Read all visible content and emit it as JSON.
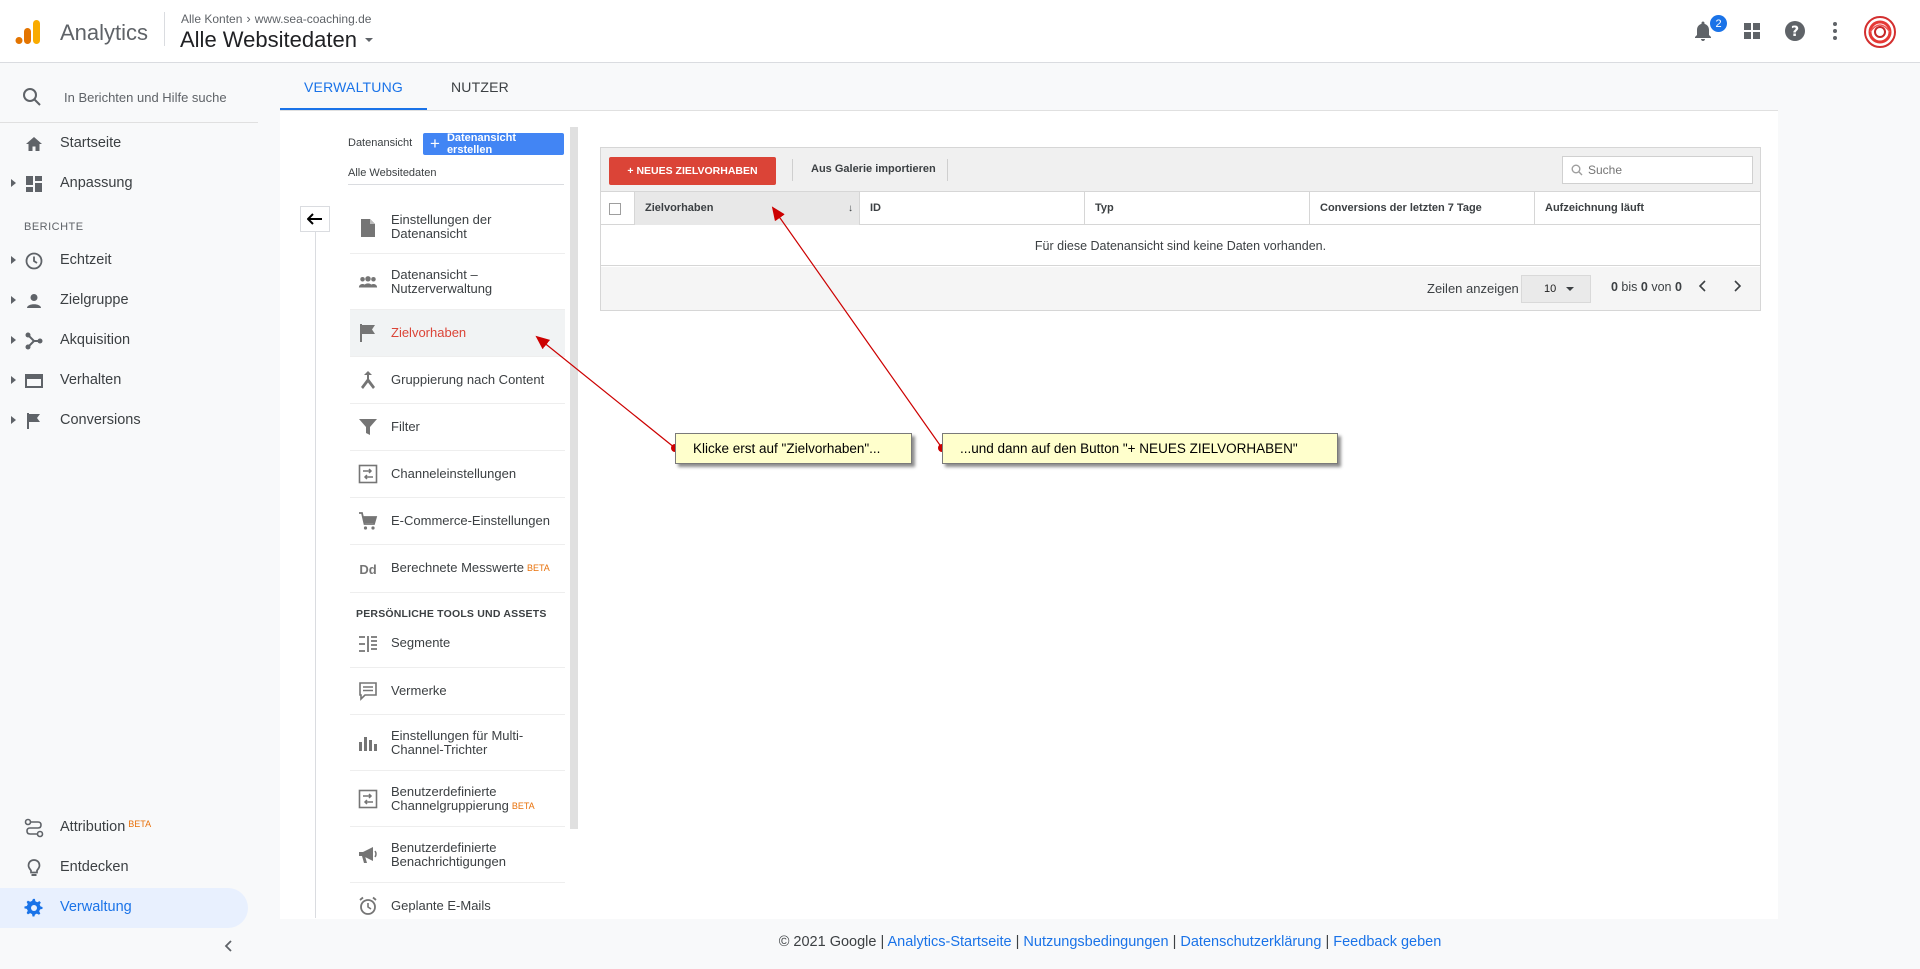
{
  "app": {
    "name": "Analytics",
    "breadcrumb_account": "Alle Konten",
    "breadcrumb_property": "www.sea-coaching.de",
    "view_title": "Alle Websitedaten",
    "notification_count": "2"
  },
  "colors": {
    "accent": "#1a73e8",
    "primary_red": "#db4437",
    "create_blue": "#4285f4",
    "callout_bg": "#ffffcc"
  },
  "icons": [
    "analytics-logo-icon",
    "search-icon",
    "home-icon",
    "dashboard-icon",
    "clock-icon",
    "person-icon",
    "acquisition-icon",
    "behavior-icon",
    "flag-icon",
    "attribution-icon",
    "lightbulb-icon",
    "gear-icon",
    "bell-icon",
    "apps-icon",
    "help-icon",
    "more-vert-icon"
  ],
  "leftnav": {
    "search_placeholder": "In Berichten und Hilfe suche",
    "items": [
      {
        "label": "Startseite"
      },
      {
        "label": "Anpassung"
      }
    ],
    "reports_heading": "BERICHTE",
    "reports": [
      {
        "label": "Echtzeit"
      },
      {
        "label": "Zielgruppe"
      },
      {
        "label": "Akquisition"
      },
      {
        "label": "Verhalten"
      },
      {
        "label": "Conversions"
      }
    ],
    "bottom": [
      {
        "label": "Attribution",
        "badge": "BETA"
      },
      {
        "label": "Entdecken"
      },
      {
        "label": "Verwaltung"
      }
    ]
  },
  "tabs": [
    {
      "label": "VERWALTUNG",
      "active": true
    },
    {
      "label": "NUTZER",
      "active": false
    }
  ],
  "view_column": {
    "label": "Datenansicht",
    "create_button": "Datenansicht erstellen",
    "selected_view": "Alle Websitedaten",
    "menu": [
      {
        "label": "Einstellungen der Datenansicht"
      },
      {
        "label": "Datenansicht – Nutzerverwaltung"
      },
      {
        "label": "Zielvorhaben",
        "active": true
      },
      {
        "label": "Gruppierung nach Content"
      },
      {
        "label": "Filter"
      },
      {
        "label": "Channeleinstellungen"
      },
      {
        "label": "E-Commerce-Einstellungen"
      },
      {
        "label": "Berechnete Messwerte",
        "badge": "BETA"
      }
    ],
    "tools_heading": "PERSÖNLICHE TOOLS UND ASSETS",
    "tools": [
      {
        "label": "Segmente"
      },
      {
        "label": "Vermerke"
      },
      {
        "label": "Einstellungen für Multi-Channel-Trichter"
      },
      {
        "label": "Benutzerdefinierte Channelgruppierung",
        "badge": "BETA"
      },
      {
        "label": "Benutzerdefinierte Benachrichtigungen"
      },
      {
        "label": "Geplante E-Mails"
      }
    ],
    "dd_icon_text": "Dd"
  },
  "goals": {
    "new_goal_button": "+ NEUES ZIELVORHABEN",
    "import_button": "Aus Galerie importieren",
    "search_placeholder": "Suche",
    "columns": [
      "Zielvorhaben",
      "ID",
      "Typ",
      "Conversions der letzten 7 Tage",
      "Aufzeichnung läuft"
    ],
    "sort_indicator": "↓",
    "empty_message": "Für diese Datenansicht sind keine Daten vorhanden.",
    "rows_label": "Zeilen anzeigen",
    "rows_value": "10",
    "range_from": "0",
    "range_mid": " bis ",
    "range_to": "0",
    "range_of": " von ",
    "range_total": "0"
  },
  "callouts": {
    "first": "Klicke erst auf \"Zielvorhaben\"...",
    "second": "...und dann auf den Button \"+ NEUES ZIELVORHABEN\""
  },
  "footer": {
    "copyright": "© 2021 Google | ",
    "links": [
      "Analytics-Startseite",
      "Nutzungsbedingungen",
      "Datenschutzerklärung",
      "Feedback geben"
    ],
    "separator": " | "
  }
}
